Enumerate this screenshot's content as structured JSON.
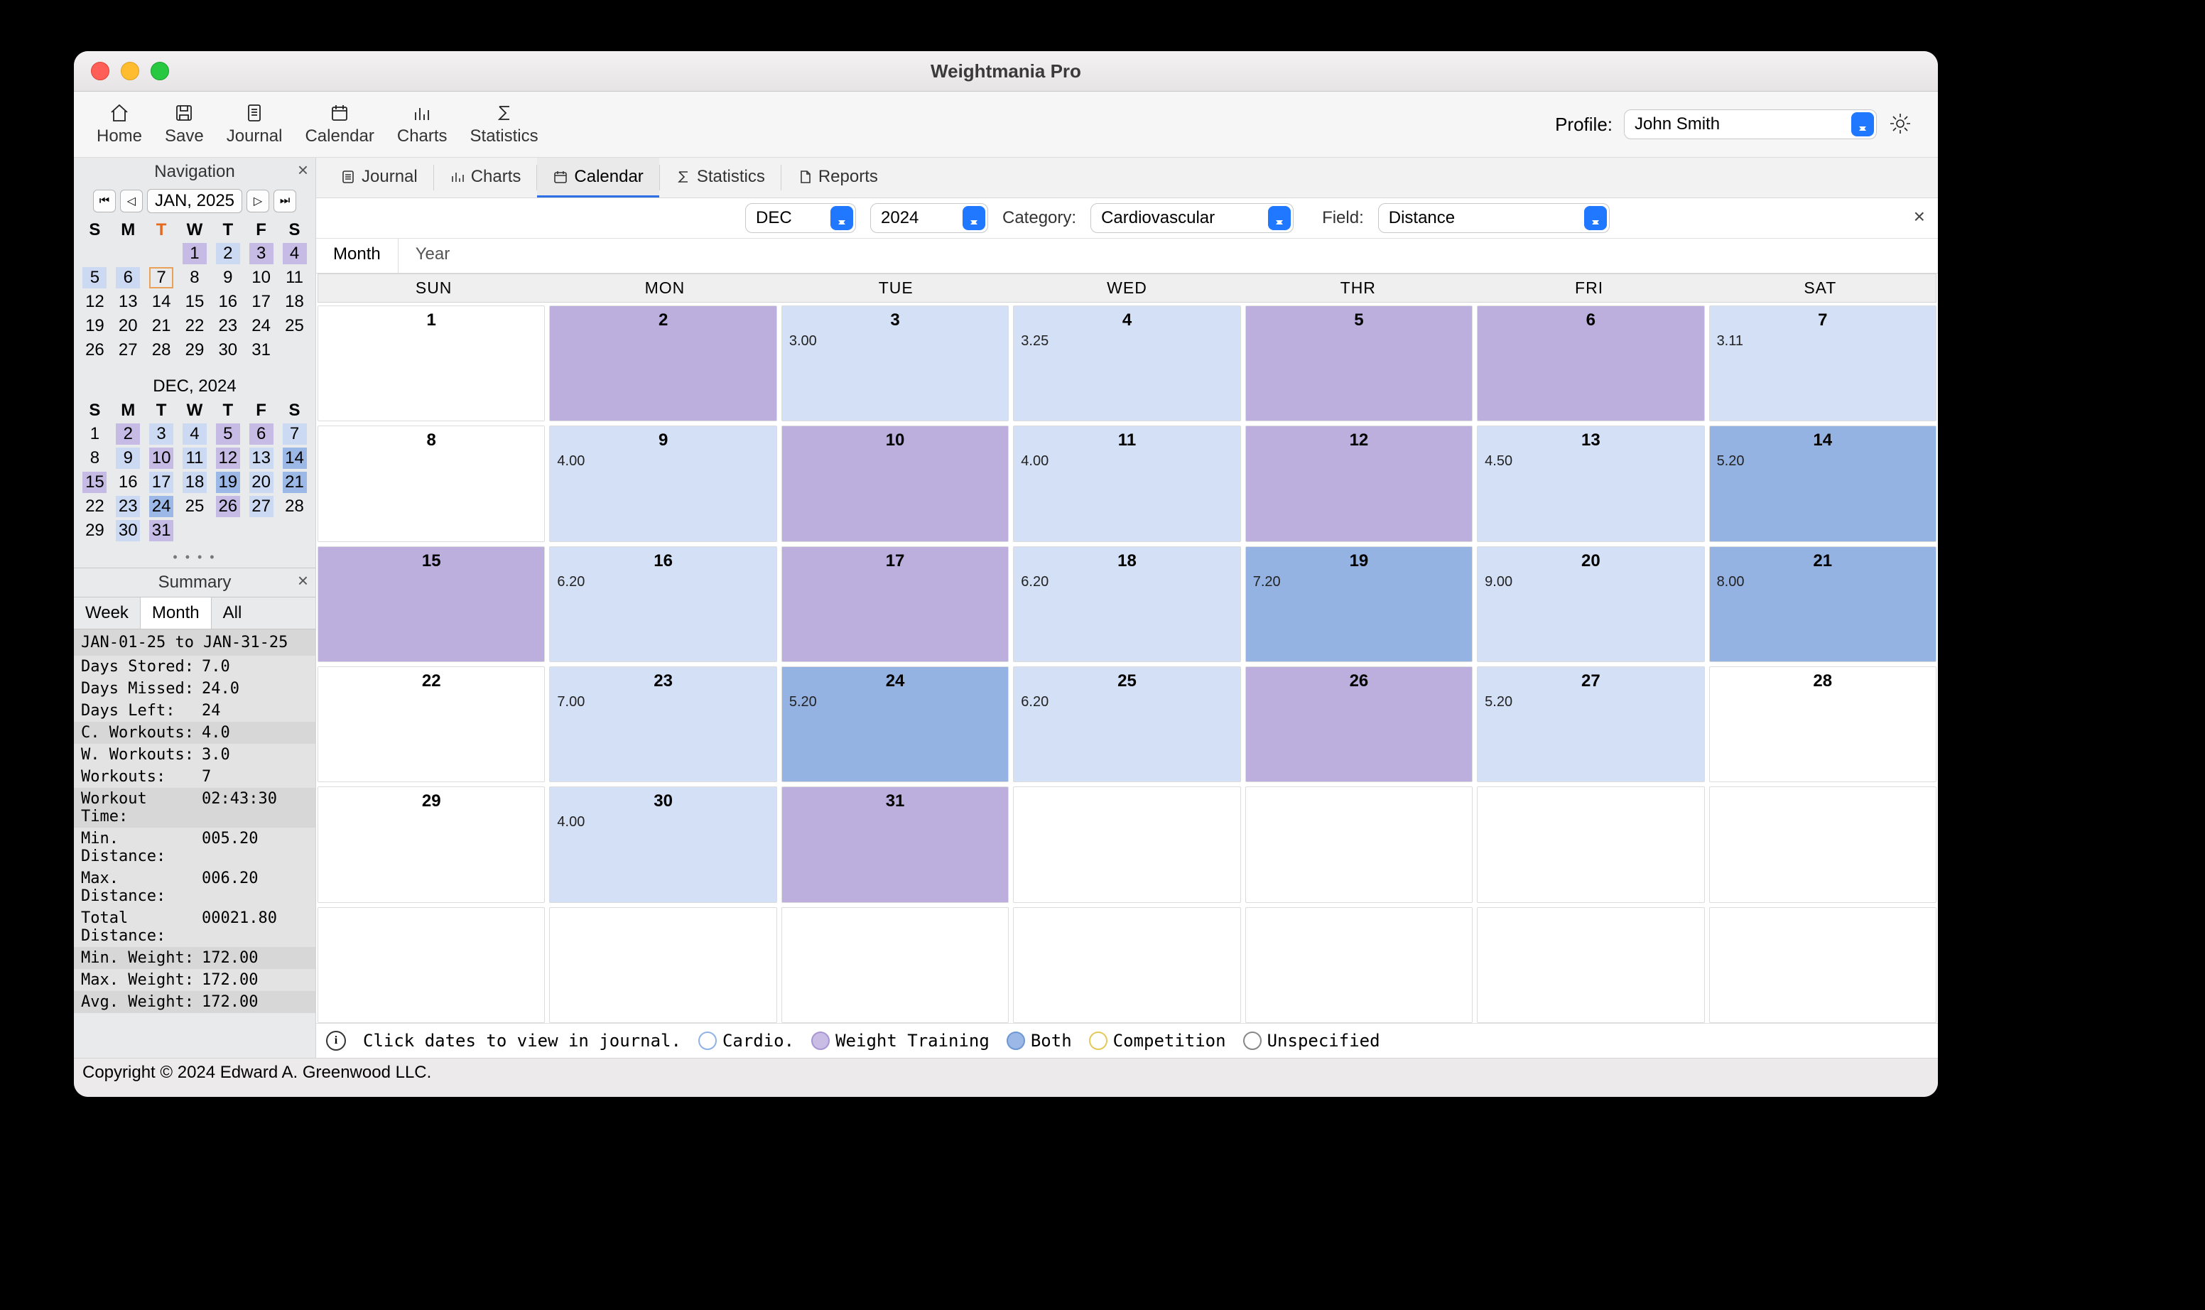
{
  "title": "Weightmania Pro",
  "toolbar": {
    "home": "Home",
    "save": "Save",
    "journal": "Journal",
    "calendar": "Calendar",
    "charts": "Charts",
    "statistics": "Statistics"
  },
  "profile": {
    "label": "Profile:",
    "value": "John Smith"
  },
  "sidebar": {
    "navigation_title": "Navigation",
    "month_label": "JAN, 2025",
    "jan_title": "",
    "dec_title": "DEC, 2024",
    "dow": [
      "S",
      "M",
      "T",
      "W",
      "T",
      "F",
      "S"
    ],
    "jan": [
      [
        null,
        null,
        null,
        {
          "d": 1,
          "s": "wt"
        },
        {
          "d": 2,
          "s": "cardio"
        },
        {
          "d": 3,
          "s": "wt"
        },
        {
          "d": 4,
          "s": "wt"
        }
      ],
      [
        {
          "d": 5,
          "s": "cardio"
        },
        {
          "d": 6,
          "s": "cardio"
        },
        {
          "d": 7,
          "s": "",
          "today": true
        },
        {
          "d": 8
        },
        {
          "d": 9
        },
        {
          "d": 10
        },
        {
          "d": 11
        }
      ],
      [
        {
          "d": 12
        },
        {
          "d": 13
        },
        {
          "d": 14
        },
        {
          "d": 15
        },
        {
          "d": 16
        },
        {
          "d": 17
        },
        {
          "d": 18
        }
      ],
      [
        {
          "d": 19
        },
        {
          "d": 20
        },
        {
          "d": 21
        },
        {
          "d": 22
        },
        {
          "d": 23
        },
        {
          "d": 24
        },
        {
          "d": 25
        }
      ],
      [
        {
          "d": 26
        },
        {
          "d": 27
        },
        {
          "d": 28
        },
        {
          "d": 29
        },
        {
          "d": 30
        },
        {
          "d": 31
        },
        null
      ]
    ],
    "dec": [
      [
        {
          "d": 1
        },
        {
          "d": 2,
          "s": "wt"
        },
        {
          "d": 3,
          "s": "cardio"
        },
        {
          "d": 4,
          "s": "cardio"
        },
        {
          "d": 5,
          "s": "wt"
        },
        {
          "d": 6,
          "s": "wt"
        },
        {
          "d": 7,
          "s": "cardio"
        }
      ],
      [
        {
          "d": 8
        },
        {
          "d": 9,
          "s": "cardio"
        },
        {
          "d": 10,
          "s": "wt"
        },
        {
          "d": 11,
          "s": "cardio"
        },
        {
          "d": 12,
          "s": "wt"
        },
        {
          "d": 13,
          "s": "cardio"
        },
        {
          "d": 14,
          "s": "both"
        }
      ],
      [
        {
          "d": 15,
          "s": "wt"
        },
        {
          "d": 16
        },
        {
          "d": 17,
          "s": "cardio"
        },
        {
          "d": 18,
          "s": "cardio"
        },
        {
          "d": 19,
          "s": "both"
        },
        {
          "d": 20,
          "s": "cardio"
        },
        {
          "d": 21,
          "s": "both"
        }
      ],
      [
        {
          "d": 22
        },
        {
          "d": 23,
          "s": "cardio"
        },
        {
          "d": 24,
          "s": "both"
        },
        {
          "d": 25
        },
        {
          "d": 26,
          "s": "wt"
        },
        {
          "d": 27,
          "s": "cardio"
        },
        {
          "d": 28
        }
      ],
      [
        {
          "d": 29
        },
        {
          "d": 30,
          "s": "cardio"
        },
        {
          "d": 31,
          "s": "wt"
        },
        null,
        null,
        null,
        null
      ]
    ],
    "summary_title": "Summary",
    "summary_tabs": {
      "week": "Week",
      "month": "Month",
      "all": "All"
    },
    "summary": {
      "range": "JAN-01-25 to JAN-31-25",
      "rows": [
        {
          "k": "Days Stored:",
          "v": "7.0"
        },
        {
          "k": "Days Missed:",
          "v": "24.0"
        },
        {
          "k": "Days Left:",
          "v": "24"
        },
        {
          "k": "C. Workouts:",
          "v": "4.0",
          "alt": true
        },
        {
          "k": "W. Workouts:",
          "v": "3.0"
        },
        {
          "k": "Workouts:",
          "v": "7"
        },
        {
          "k": "Workout Time:",
          "v": "02:43:30",
          "alt": true
        },
        {
          "k": "Min. Distance:",
          "v": "005.20"
        },
        {
          "k": "Max. Distance:",
          "v": "006.20"
        },
        {
          "k": "Total Distance:",
          "v": "00021.80"
        },
        {
          "k": "Min. Weight:",
          "v": "172.00",
          "alt": true
        },
        {
          "k": "Max. Weight:",
          "v": "172.00"
        },
        {
          "k": "Avg. Weight:",
          "v": "172.00",
          "alt": true
        }
      ]
    }
  },
  "tabs": {
    "journal": "Journal",
    "charts": "Charts",
    "calendar": "Calendar",
    "statistics": "Statistics",
    "reports": "Reports"
  },
  "filters": {
    "month": "DEC",
    "year": "2024",
    "category_label": "Category:",
    "category": "Cardiovascular",
    "field_label": "Field:",
    "field": "Distance"
  },
  "viewtabs": {
    "month": "Month",
    "year": "Year"
  },
  "weekdays": [
    "SUN",
    "MON",
    "TUE",
    "WED",
    "THR",
    "FRI",
    "SAT"
  ],
  "weeks": [
    [
      {
        "d": 1
      },
      {
        "d": 2,
        "s": "wt"
      },
      {
        "d": 3,
        "v": "3.00",
        "s": "cardio"
      },
      {
        "d": 4,
        "v": "3.25",
        "s": "cardio"
      },
      {
        "d": 5,
        "s": "wt"
      },
      {
        "d": 6,
        "s": "wt"
      },
      {
        "d": 7,
        "v": "3.11",
        "s": "cardio"
      }
    ],
    [
      {
        "d": 8
      },
      {
        "d": 9,
        "v": "4.00",
        "s": "cardio"
      },
      {
        "d": 10,
        "s": "wt"
      },
      {
        "d": 11,
        "v": "4.00",
        "s": "cardio"
      },
      {
        "d": 12,
        "s": "wt"
      },
      {
        "d": 13,
        "v": "4.50",
        "s": "cardio"
      },
      {
        "d": 14,
        "v": "5.20",
        "s": "both"
      }
    ],
    [
      {
        "d": 15,
        "s": "wt"
      },
      {
        "d": 16,
        "v": "6.20",
        "s": "cardio"
      },
      {
        "d": 17,
        "s": "wt"
      },
      {
        "d": 18,
        "v": "6.20",
        "s": "cardio"
      },
      {
        "d": 19,
        "v": "7.20",
        "s": "both"
      },
      {
        "d": 20,
        "v": "9.00",
        "s": "cardio"
      },
      {
        "d": 21,
        "v": "8.00",
        "s": "both"
      }
    ],
    [
      {
        "d": 22
      },
      {
        "d": 23,
        "v": "7.00",
        "s": "cardio"
      },
      {
        "d": 24,
        "v": "5.20",
        "s": "both"
      },
      {
        "d": 25,
        "v": "6.20",
        "s": "cardio"
      },
      {
        "d": 26,
        "s": "wt"
      },
      {
        "d": 27,
        "v": "5.20",
        "s": "cardio"
      },
      {
        "d": 28
      }
    ],
    [
      {
        "d": 29
      },
      {
        "d": 30,
        "v": "4.00",
        "s": "cardio"
      },
      {
        "d": 31,
        "s": "wt"
      },
      {},
      {},
      {},
      {}
    ],
    [
      {},
      {},
      {},
      {},
      {},
      {},
      {}
    ]
  ],
  "legend": {
    "hint": "Click dates to view in journal.",
    "cardio": "Cardio.",
    "wt": "Weight Training",
    "both": "Both",
    "comp": "Competition",
    "unspec": "Unspecified"
  },
  "footer": "Copyright © 2024 Edward A. Greenwood LLC."
}
